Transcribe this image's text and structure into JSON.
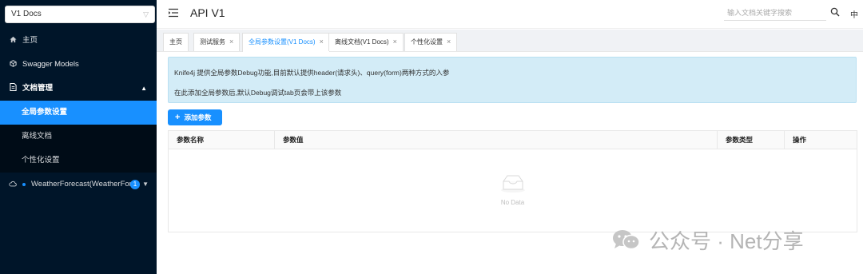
{
  "sidebar": {
    "version_select": "V1 Docs",
    "items": [
      {
        "label": "主页",
        "icon": "home-icon"
      },
      {
        "label": "Swagger Models",
        "icon": "models-icon"
      },
      {
        "label": "文档管理",
        "icon": "document-icon"
      }
    ],
    "doc_manage_children": [
      {
        "label": "全局参数设置",
        "active": true
      },
      {
        "label": "离线文档",
        "active": false
      },
      {
        "label": "个性化设置",
        "active": false
      }
    ],
    "weather": {
      "label": "WeatherForecast(WeatherForecast)",
      "badge": "1"
    }
  },
  "header": {
    "title": "API V1",
    "search_placeholder": "输入文档关键字搜索",
    "lang": "中"
  },
  "tabs": [
    {
      "label": "主页",
      "closable": false,
      "active": false
    },
    {
      "label": "测试服务",
      "closable": true,
      "active": false
    },
    {
      "label": "全局参数设置(V1 Docs)",
      "closable": true,
      "active": true
    },
    {
      "label": "离线文档(V1 Docs)",
      "closable": true,
      "active": false
    },
    {
      "label": "个性化设置",
      "closable": true,
      "active": false
    }
  ],
  "main": {
    "info_line1": "Knife4j 提供全局参数Debug功能,目前默认提供header(请求头)、query(form)两种方式的入参",
    "info_line2": "在此添加全局参数后,默认Debug调试tab页会带上该参数",
    "add_button": "添加参数",
    "columns": [
      "参数名称",
      "参数值",
      "参数类型",
      "操作"
    ],
    "empty_text": "No Data"
  },
  "watermark": {
    "text": "公众号 · Net分享"
  },
  "colors": {
    "sidebar_bg": "#001529",
    "accent": "#1890ff",
    "info_bg": "#d3ecf7"
  }
}
